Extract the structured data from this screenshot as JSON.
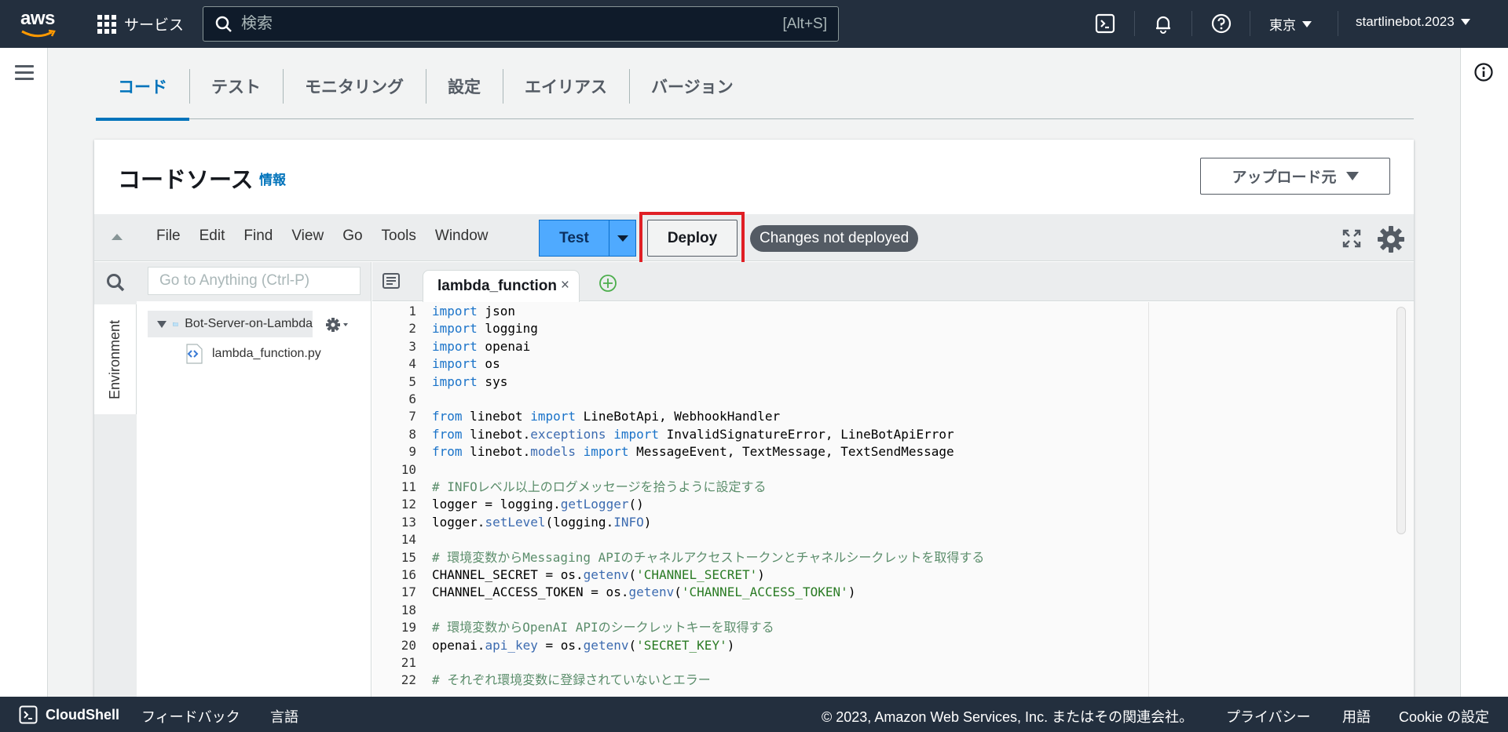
{
  "topnav": {
    "logo_text": "aws",
    "services_label": "サービス",
    "search_placeholder": "検索",
    "search_shortcut": "[Alt+S]",
    "region": "東京",
    "account": "startlinebot.2023",
    "icons": [
      "cloudshell-icon",
      "bell-icon",
      "help-icon"
    ]
  },
  "tabs": [
    {
      "label": "コード",
      "active": true
    },
    {
      "label": "テスト",
      "active": false
    },
    {
      "label": "モニタリング",
      "active": false
    },
    {
      "label": "設定",
      "active": false
    },
    {
      "label": "エイリアス",
      "active": false
    },
    {
      "label": "バージョン",
      "active": false
    }
  ],
  "panel": {
    "title": "コードソース",
    "info_link": "情報",
    "upload_label": "アップロード元"
  },
  "toolbar": {
    "menu": [
      "File",
      "Edit",
      "Find",
      "View",
      "Go",
      "Tools",
      "Window"
    ],
    "test_label": "Test",
    "deploy_label": "Deploy",
    "status": "Changes not deployed",
    "highlight_color": "#e01f25"
  },
  "sidebar": {
    "goto_placeholder": "Go to Anything (Ctrl-P)",
    "env_tab": "Environment",
    "folder": "Bot-Server-on-Lambda",
    "file": "lambda_function.py"
  },
  "editor": {
    "tab_name": "lambda_function",
    "line_count": 22,
    "lines": [
      [
        {
          "t": "import",
          "c": "kw"
        },
        {
          "t": " json"
        }
      ],
      [
        {
          "t": "import",
          "c": "kw"
        },
        {
          "t": " logging"
        }
      ],
      [
        {
          "t": "import",
          "c": "kw"
        },
        {
          "t": " openai"
        }
      ],
      [
        {
          "t": "import",
          "c": "kw"
        },
        {
          "t": " os"
        }
      ],
      [
        {
          "t": "import",
          "c": "kw"
        },
        {
          "t": " sys"
        }
      ],
      [],
      [
        {
          "t": "from",
          "c": "kw"
        },
        {
          "t": " linebot "
        },
        {
          "t": "import",
          "c": "kw"
        },
        {
          "t": " LineBotApi, WebhookHandler"
        }
      ],
      [
        {
          "t": "from",
          "c": "kw"
        },
        {
          "t": " linebot."
        },
        {
          "t": "exceptions",
          "c": "fn"
        },
        {
          "t": " "
        },
        {
          "t": "import",
          "c": "kw"
        },
        {
          "t": " InvalidSignatureError, LineBotApiError"
        }
      ],
      [
        {
          "t": "from",
          "c": "kw"
        },
        {
          "t": " linebot."
        },
        {
          "t": "models",
          "c": "fn"
        },
        {
          "t": " "
        },
        {
          "t": "import",
          "c": "kw"
        },
        {
          "t": " MessageEvent, TextMessage, TextSendMessage"
        }
      ],
      [],
      [
        {
          "t": "# INFOレベル以上のログメッセージを拾うように設定する",
          "c": "cm"
        }
      ],
      [
        {
          "t": "logger = logging."
        },
        {
          "t": "getLogger",
          "c": "fn"
        },
        {
          "t": "()"
        }
      ],
      [
        {
          "t": "logger."
        },
        {
          "t": "setLevel",
          "c": "fn"
        },
        {
          "t": "(logging."
        },
        {
          "t": "INFO",
          "c": "fn"
        },
        {
          "t": ")"
        }
      ],
      [],
      [
        {
          "t": "# 環境変数からMessaging APIのチャネルアクセストークンとチャネルシークレットを取得する",
          "c": "cm"
        }
      ],
      [
        {
          "t": "CHANNEL_SECRET = os."
        },
        {
          "t": "getenv",
          "c": "fn"
        },
        {
          "t": "("
        },
        {
          "t": "'CHANNEL_SECRET'",
          "c": "st"
        },
        {
          "t": ")"
        }
      ],
      [
        {
          "t": "CHANNEL_ACCESS_TOKEN = os."
        },
        {
          "t": "getenv",
          "c": "fn"
        },
        {
          "t": "("
        },
        {
          "t": "'CHANNEL_ACCESS_TOKEN'",
          "c": "st"
        },
        {
          "t": ")"
        }
      ],
      [],
      [
        {
          "t": "# 環境変数からOpenAI APIのシークレットキーを取得する",
          "c": "cm"
        }
      ],
      [
        {
          "t": "openai."
        },
        {
          "t": "api_key",
          "c": "fn"
        },
        {
          "t": " = os."
        },
        {
          "t": "getenv",
          "c": "fn"
        },
        {
          "t": "("
        },
        {
          "t": "'SECRET_KEY'",
          "c": "st"
        },
        {
          "t": ")"
        }
      ],
      [],
      [
        {
          "t": "# それぞれ環境変数に登録されていないとエラー",
          "c": "cm"
        }
      ]
    ]
  },
  "footer": {
    "cloudshell": "CloudShell",
    "feedback": "フィードバック",
    "language": "言語",
    "copyright": "© 2023, Amazon Web Services, Inc. またはその関連会社。",
    "privacy": "プライバシー",
    "terms": "用語",
    "cookie": "Cookie の設定"
  }
}
